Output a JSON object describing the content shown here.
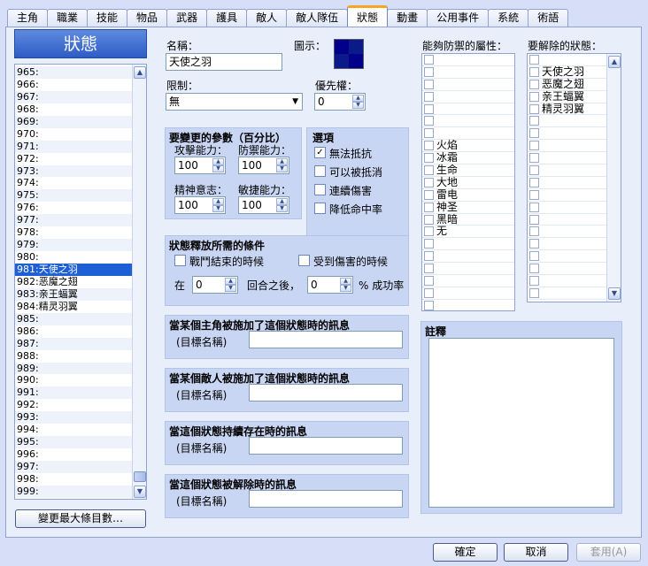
{
  "tabs": [
    "主角",
    "職業",
    "技能",
    "物品",
    "武器",
    "護具",
    "敵人",
    "敵人隊伍",
    "狀態",
    "動畫",
    "公用事件",
    "系統",
    "術語"
  ],
  "active_tab_index": 8,
  "list": {
    "title": "狀態",
    "rows": [
      "965:",
      "966:",
      "967:",
      "968:",
      "969:",
      "970:",
      "971:",
      "972:",
      "973:",
      "974:",
      "975:",
      "976:",
      "977:",
      "978:",
      "979:",
      "980:",
      "981:天使之羽",
      "982:恶魔之翅",
      "983:亲王蝠翼",
      "984:精灵羽翼",
      "985:",
      "986:",
      "987:",
      "988:",
      "989:",
      "990:",
      "991:",
      "992:",
      "993:",
      "994:",
      "995:",
      "996:",
      "997:",
      "998:",
      "999:"
    ],
    "selected_index": 16,
    "change_max_button": "變更最大條目數…"
  },
  "form": {
    "name_label": "名稱：",
    "name_value": "天使之羽",
    "icon_label": "圖示：",
    "restriction_label": "限制：",
    "restriction_value": "無",
    "priority_label": "優先權：",
    "priority_value": "0",
    "params_title": "要變更的參數（百分比）",
    "attack_label": "攻擊能力：",
    "attack_value": "100",
    "defense_label": "防禦能力：",
    "defense_value": "100",
    "spirit_label": "精神意志：",
    "spirit_value": "100",
    "agility_label": "敏捷能力：",
    "agility_value": "100",
    "options_title": "選項",
    "options": [
      {
        "label": "無法抵抗",
        "checked": true
      },
      {
        "label": "可以被抵消",
        "checked": false
      },
      {
        "label": "連續傷害",
        "checked": false
      },
      {
        "label": "降低命中率",
        "checked": false
      }
    ],
    "release_title": "狀態釋放所需的條件",
    "battle_end_label": "戰鬥結束的時候",
    "on_damage_label": "受到傷害的時候",
    "at_label": "在",
    "turns_value": "0",
    "after_turns_label": "回合之後，",
    "percent_value": "0",
    "success_label": "% 成功率",
    "msg_actor_title": "當某個主角被施加了這個狀態時的訊息",
    "msg_enemy_title": "當某個敵人被施加了這個狀態時的訊息",
    "msg_persist_title": "當這個狀態持續存在時的訊息",
    "msg_remove_title": "當這個狀態被解除時的訊息",
    "target_name_label": "(目標名稱)"
  },
  "resist": {
    "title": "能夠防禦的屬性：",
    "items": [
      "",
      "",
      "",
      "",
      "",
      "",
      "",
      "火焰",
      "冰霜",
      "生命",
      "大地",
      "雷电",
      "神圣",
      "黑暗",
      "无"
    ]
  },
  "remove": {
    "title": "要解除的狀態：",
    "items": [
      "",
      "天使之羽",
      "恶魔之翅",
      "亲王蝠翼",
      "精灵羽翼",
      "",
      "",
      "",
      "",
      "",
      "",
      "",
      "",
      "",
      "",
      "",
      "",
      "",
      "",
      ""
    ]
  },
  "note": {
    "title": "註釋"
  },
  "footer": {
    "ok": "確定",
    "cancel": "取消",
    "apply": "套用(A)"
  }
}
